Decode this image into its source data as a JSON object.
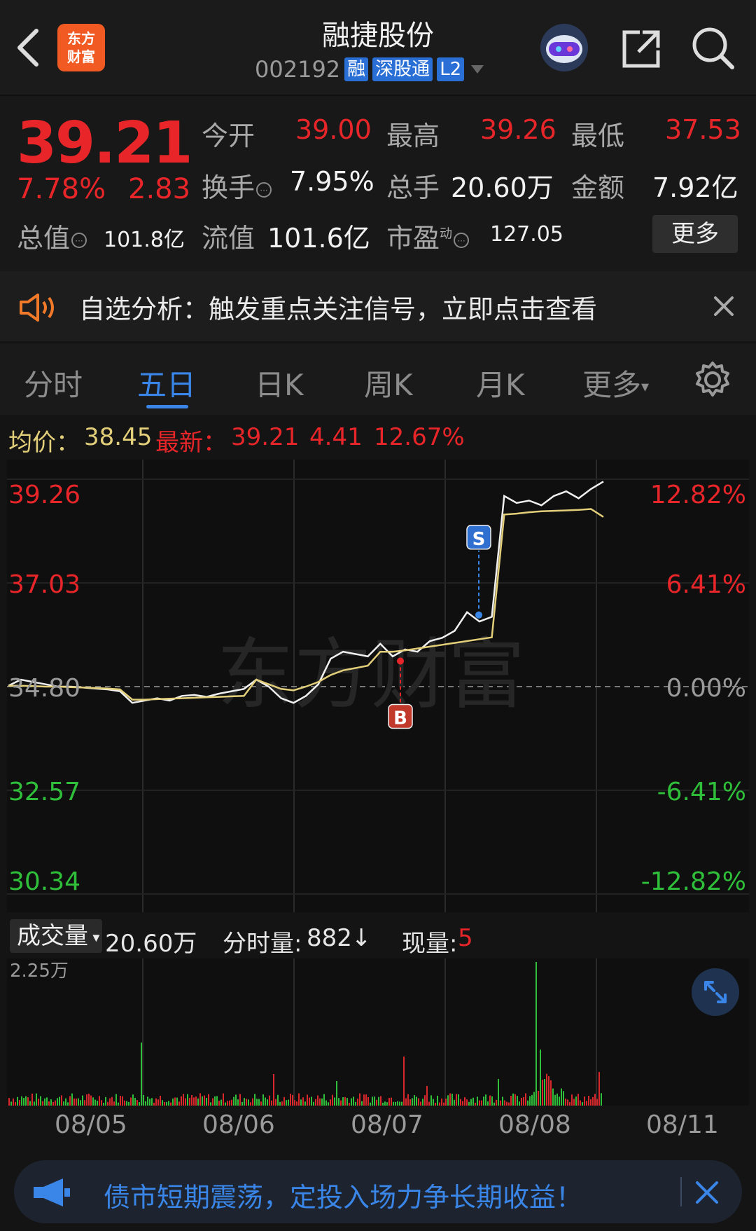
{
  "header": {
    "logo_line1": "东方",
    "logo_line2": "财富",
    "title": "融捷股份",
    "code": "002192",
    "tags": [
      "融",
      "深股通",
      "L2"
    ]
  },
  "quote": {
    "price": "39.21",
    "change_pct": "7.78%",
    "change": "2.83",
    "open_label": "今开",
    "open": "39.00",
    "high_label": "最高",
    "high": "39.26",
    "low_label": "最低",
    "low": "37.53",
    "turnover_label": "换手",
    "turnover": "7.95%",
    "volume_label": "总手",
    "volume": "20.60万",
    "amount_label": "金额",
    "amount": "7.92亿",
    "total_value_label": "总值",
    "total_value": "101.8亿",
    "float_value_label": "流值",
    "float_value": "101.6亿",
    "pe_label": "市盈",
    "pe_superscript": "动",
    "pe": "127.05",
    "more_label": "更多"
  },
  "banner": {
    "text": "自选分析：触发重点关注信号，立即点击查看"
  },
  "tabs": [
    {
      "label": "分时"
    },
    {
      "label": "五日"
    },
    {
      "label": "日K"
    },
    {
      "label": "周K"
    },
    {
      "label": "月K"
    },
    {
      "label": "更多"
    }
  ],
  "chart_head": {
    "avg_label": "均价：",
    "avg": "38.45",
    "latest_label": "最新：",
    "latest": "39.21",
    "change": "4.41",
    "change_pct": "12.67%"
  },
  "chart_data": {
    "type": "line",
    "watermark": "东方财富",
    "y_left": [
      "39.26",
      "37.03",
      "34.80",
      "32.57",
      "30.34"
    ],
    "y_right": [
      "12.82%",
      "6.41%",
      "0.00%",
      "-6.41%",
      "-12.82%"
    ],
    "x_categories": [
      "08/05",
      "08/06",
      "08/07",
      "08/08",
      "08/11"
    ],
    "base_price": 34.8,
    "ylim": [
      30.34,
      39.26
    ],
    "markers": [
      {
        "label": "B",
        "day": "08/07",
        "price": 35.35
      },
      {
        "label": "S",
        "day": "08/08",
        "price": 36.34
      }
    ],
    "series": [
      {
        "name": "price",
        "color": "#f0f0f0",
        "values": [
          34.82,
          34.95,
          34.9,
          34.85,
          34.8,
          34.8,
          34.78,
          34.76,
          34.74,
          34.7,
          34.45,
          34.5,
          34.55,
          34.5,
          34.6,
          34.62,
          34.58,
          34.65,
          34.7,
          34.75,
          34.95,
          34.8,
          34.55,
          34.45,
          34.6,
          34.85,
          35.4,
          35.55,
          35.5,
          35.45,
          35.72,
          35.45,
          35.6,
          35.55,
          35.78,
          35.85,
          36.0,
          36.4,
          36.2,
          36.3,
          38.9,
          38.75,
          38.8,
          38.7,
          38.9,
          39.0,
          38.85,
          39.05,
          39.21
        ]
      },
      {
        "name": "avg",
        "color": "#e3cf7a",
        "values": [
          34.82,
          34.82,
          34.81,
          34.8,
          34.8,
          34.79,
          34.78,
          34.77,
          34.76,
          34.74,
          34.52,
          34.52,
          34.53,
          34.54,
          34.55,
          34.56,
          34.57,
          34.58,
          34.59,
          34.6,
          34.95,
          34.85,
          34.75,
          34.72,
          34.8,
          34.9,
          35.05,
          35.15,
          35.2,
          35.25,
          35.55,
          35.55,
          35.58,
          35.62,
          35.66,
          35.7,
          35.74,
          35.78,
          35.82,
          35.86,
          38.5,
          38.52,
          38.55,
          38.57,
          38.58,
          38.59,
          38.6,
          38.62,
          38.45
        ]
      }
    ]
  },
  "volume": {
    "label": "成交量",
    "total": "20.60万",
    "tick_label": "分时量:",
    "tick_value": "882",
    "tick_arrow": "↓",
    "now_label": "现量:",
    "now_value": "5",
    "ymax_label": "2.25万"
  },
  "ad": {
    "text": "债市短期震荡，定投入场力争长期收益！"
  }
}
